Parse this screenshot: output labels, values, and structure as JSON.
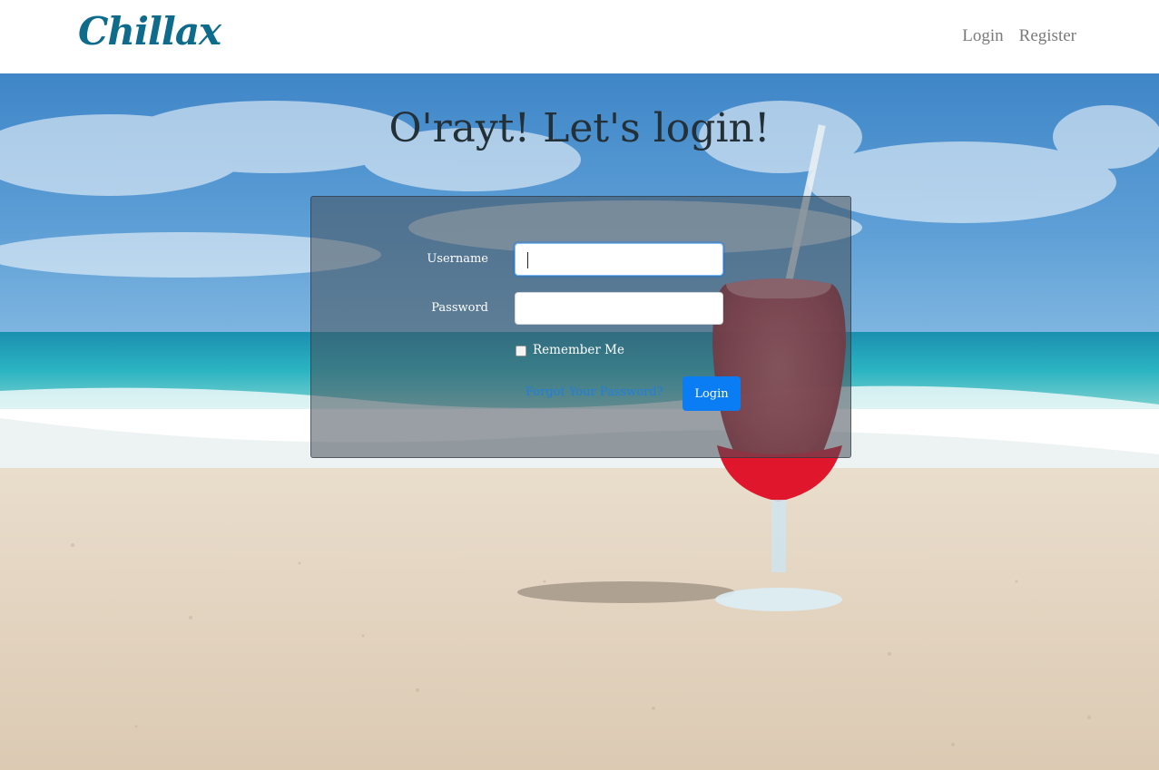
{
  "navbar": {
    "brand": "Chillax",
    "links": [
      {
        "label": "Login"
      },
      {
        "label": "Register"
      }
    ]
  },
  "hero": {
    "headline": "O'rayt! Let's login!"
  },
  "login_form": {
    "username_label": "Username",
    "username_value": "",
    "password_label": "Password",
    "password_value": "",
    "remember_label": "Remember Me",
    "remember_checked": false,
    "forgot_link": "Forgot Your Password?",
    "submit_label": "Login"
  },
  "colors": {
    "brand": "#0e6b8c",
    "primary_button": "#0a7df5",
    "link": "#1f7fe0",
    "nav_text": "#7a7a7a"
  }
}
